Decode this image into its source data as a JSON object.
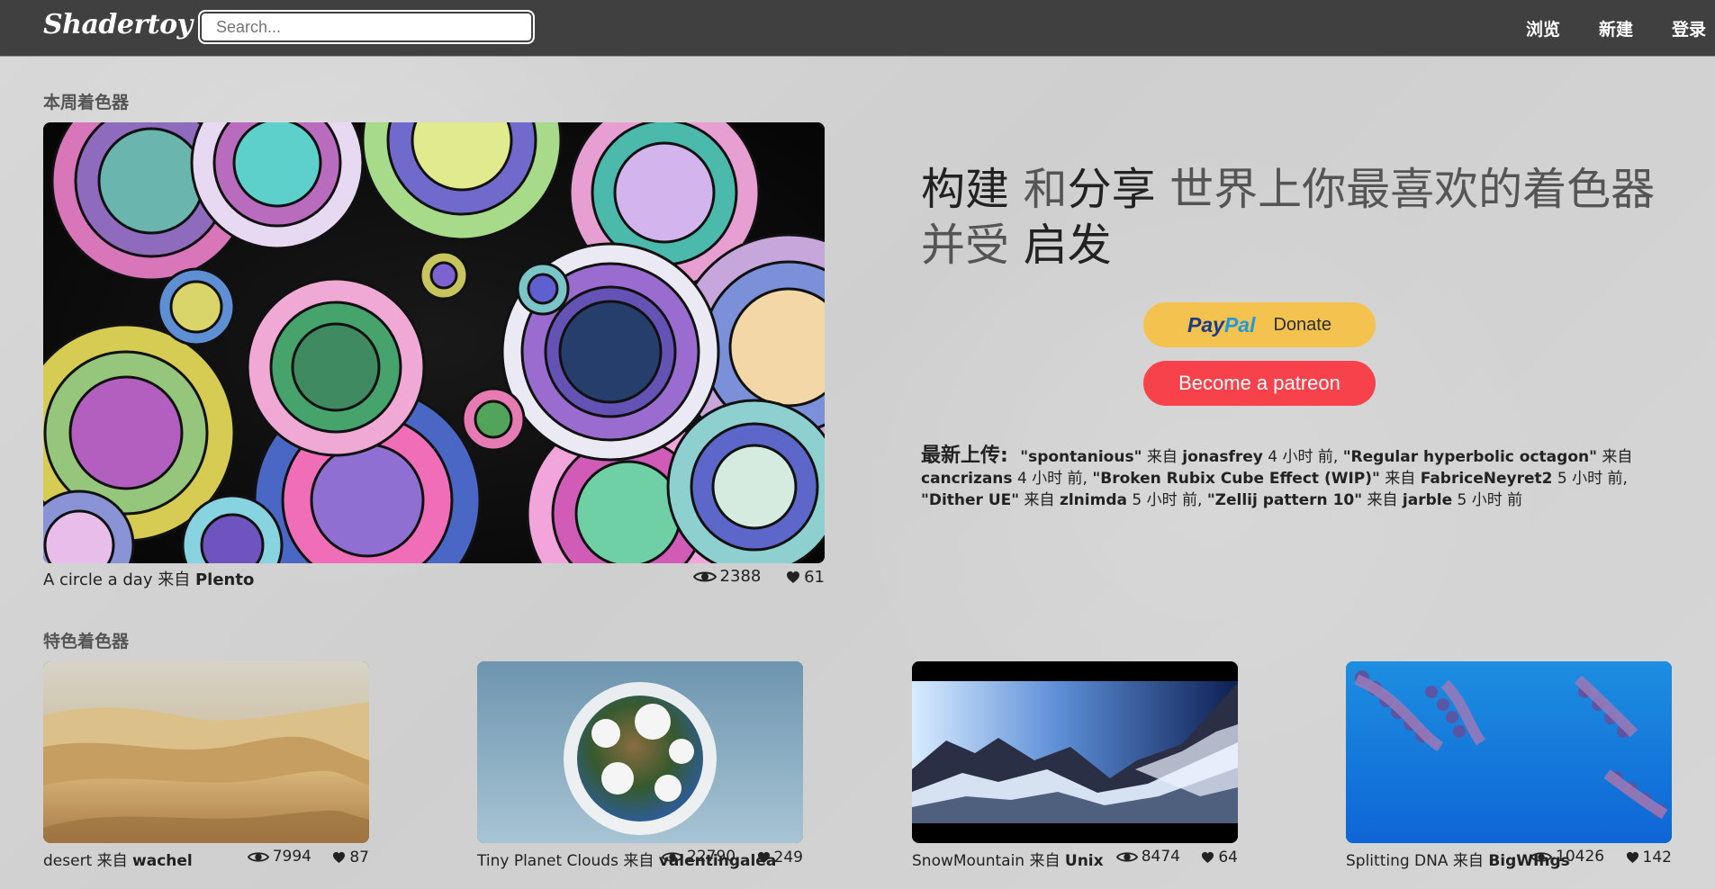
{
  "header": {
    "logo": "Shadertoy",
    "search_placeholder": "Search...",
    "nav": [
      "浏览",
      "新建",
      "登录"
    ]
  },
  "weekly": {
    "section_title": "本周着色器",
    "title": "A circle a day",
    "from_label": "来自",
    "author": "Plento",
    "views": "2388",
    "likes": "61"
  },
  "hero": {
    "line1_a": "构建 ",
    "line1_b": "和",
    "line1_c": "分享",
    "line1_d": " 世界上你最喜欢的着色器",
    "line2_a": "并受 ",
    "line2_b": "启发"
  },
  "donate": {
    "paypal_brand_a": "Pay",
    "paypal_brand_b": "Pal",
    "paypal_text": "Donate",
    "patreon_text": "Become a patreon"
  },
  "uploads": {
    "heading": "最新上传:",
    "items": [
      {
        "name": "\"spontanious\"",
        "from": "来自",
        "author": "jonasfrey",
        "time": "4 小时 前,"
      },
      {
        "name": "\"Regular hyperbolic octagon\"",
        "from": "来自",
        "author": "cancrizans",
        "time": "4 小时 前,"
      },
      {
        "name": "\"Broken Rubix Cube Effect (WIP)\"",
        "from": "来自",
        "author": "FabriceNeyret2",
        "time": "5 小时 前,"
      },
      {
        "name": "\"Dither UE\"",
        "from": "来自",
        "author": "zlnimda",
        "time": "5 小时 前,"
      },
      {
        "name": "\"Zellij pattern 10\"",
        "from": "来自",
        "author": "jarble",
        "time": "5 小时 前"
      }
    ]
  },
  "featured": {
    "section_title": "特色着色器",
    "items": [
      {
        "title": "desert",
        "from": "来自",
        "author": "wachel",
        "views": "7994",
        "likes": "87"
      },
      {
        "title": "Tiny Planet Clouds",
        "from": "来自",
        "author": "valentingalea",
        "views": "22790",
        "likes": "249"
      },
      {
        "title": "SnowMountain",
        "from": "来自",
        "author": "Unix",
        "views": "8474",
        "likes": "64"
      },
      {
        "title": "Splitting DNA",
        "from": "来自",
        "author": "BigWIngs",
        "views": "10426",
        "likes": "142"
      }
    ]
  }
}
